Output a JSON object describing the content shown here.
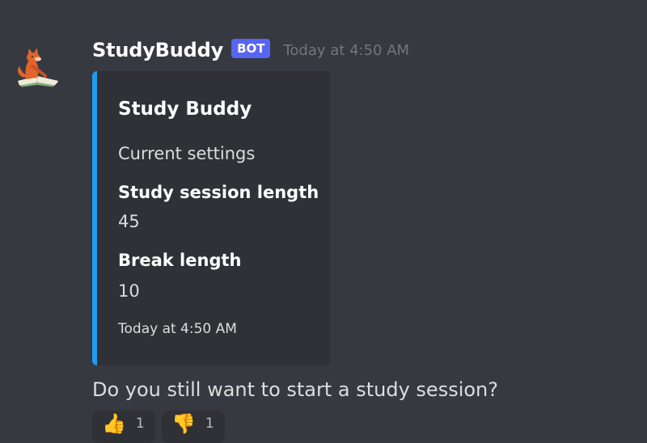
{
  "message": {
    "author": "StudyBuddy",
    "bot_tag": "BOT",
    "timestamp": "Today at 4:50 AM",
    "avatar_icon": "fox-reading-icon",
    "accent_color": "#1e9cf0",
    "embed": {
      "title": "Study Buddy",
      "description": "Current settings",
      "fields": [
        {
          "name": "Study session length",
          "value": "45"
        },
        {
          "name": "Break length",
          "value": "10"
        }
      ],
      "footer": "Today at 4:50 AM"
    },
    "content": "Do you still want to start a study session?",
    "reactions": [
      {
        "emoji": "👍",
        "icon": "thumbs-up-icon",
        "count": "1"
      },
      {
        "emoji": "👎",
        "icon": "thumbs-down-icon",
        "count": "1"
      }
    ]
  }
}
